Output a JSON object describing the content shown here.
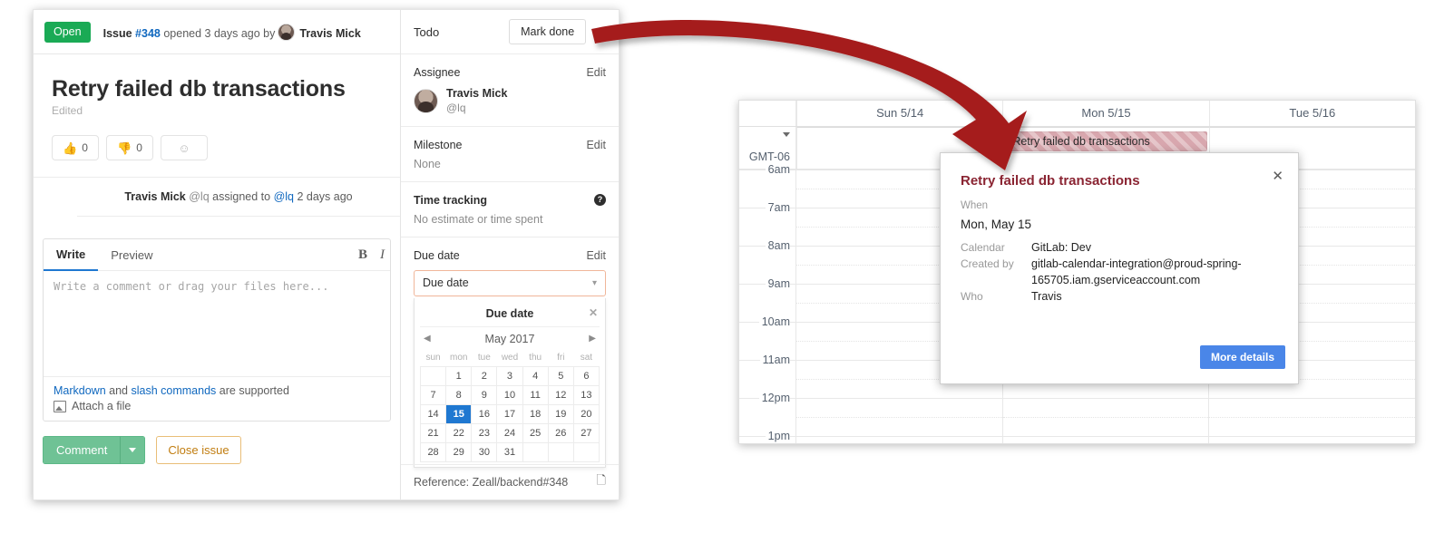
{
  "issue": {
    "status_badge": "Open",
    "meta_issue_word": "Issue",
    "issue_number": "#348",
    "meta_opened": "opened 3 days ago by",
    "author": "Travis Mick",
    "title": "Retry failed db transactions",
    "edited": "Edited",
    "awards": [
      {
        "icon": "thumbs-up",
        "glyph": "👍",
        "count": "0"
      },
      {
        "icon": "thumbs-down",
        "glyph": "👎",
        "count": "0"
      },
      {
        "icon": "add-reaction",
        "glyph": "☺",
        "count": ""
      }
    ],
    "system_note": {
      "actor": "Travis Mick",
      "actor_handle": "@lq",
      "action": "assigned to",
      "target": "@lq",
      "time": "2 days ago"
    },
    "editor": {
      "tab_write": "Write",
      "tab_preview": "Preview",
      "tool_bold": "B",
      "tool_italic": "I",
      "placeholder": "Write a comment or drag your files here...",
      "footer_markdown": "Markdown",
      "footer_and": "and",
      "footer_slash": "slash commands",
      "footer_supported": "are supported",
      "attach": "Attach a file"
    },
    "buttons": {
      "comment": "Comment",
      "close_issue": "Close issue"
    }
  },
  "sidebar": {
    "todo_label": "Todo",
    "mark_done": "Mark done",
    "collapse_icon": "»",
    "assignee": {
      "label": "Assignee",
      "edit": "Edit",
      "name": "Travis Mick",
      "handle": "@lq"
    },
    "milestone": {
      "label": "Milestone",
      "edit": "Edit",
      "value": "None"
    },
    "time_tracking": {
      "label": "Time tracking",
      "help": "?",
      "value": "No estimate or time spent"
    },
    "due_date": {
      "label": "Due date",
      "edit": "Edit",
      "select_value": "Due date",
      "picker_title": "Due date",
      "close": "✕",
      "prev": "◀",
      "next": "▶",
      "month": "May 2017",
      "weekdays": [
        "sun",
        "mon",
        "tue",
        "wed",
        "thu",
        "fri",
        "sat"
      ],
      "weeks": [
        [
          "",
          "1",
          "2",
          "3",
          "4",
          "5",
          "6"
        ],
        [
          "7",
          "8",
          "9",
          "10",
          "11",
          "12",
          "13"
        ],
        [
          "14",
          "15",
          "16",
          "17",
          "18",
          "19",
          "20"
        ],
        [
          "21",
          "22",
          "23",
          "24",
          "25",
          "26",
          "27"
        ],
        [
          "28",
          "29",
          "30",
          "31",
          "",
          "",
          ""
        ]
      ],
      "selected": "15"
    },
    "reference": "Reference: Zeall/backend#348"
  },
  "calendar": {
    "timezone": "GMT-06",
    "days": [
      "Sun 5/14",
      "Mon 5/15",
      "Tue 5/16"
    ],
    "hours": [
      "6am",
      "7am",
      "8am",
      "9am",
      "10am",
      "11am",
      "12pm",
      "1pm"
    ],
    "allday_event": {
      "title": "Retry failed db transactions",
      "column": 1,
      "color": "#d8a7ae"
    }
  },
  "event_popup": {
    "title": "Retry failed db transactions",
    "when_label": "When",
    "when_value": "Mon, May 15",
    "rows": [
      {
        "key": "Calendar",
        "value": "GitLab: Dev"
      },
      {
        "key": "Created by",
        "value": "gitlab-calendar-integration@proud-spring-165705.iam.gserviceaccount.com"
      },
      {
        "key": "Who",
        "value": "Travis"
      }
    ],
    "more_details": "More details",
    "close": "✕"
  },
  "colors": {
    "open_green": "#1aaa55",
    "link_blue": "#1068bf",
    "selected_day": "#1f78d1",
    "popup_title": "#8a2432",
    "more_details_btn": "#4a86e8",
    "arrow": "#a51d1d"
  }
}
